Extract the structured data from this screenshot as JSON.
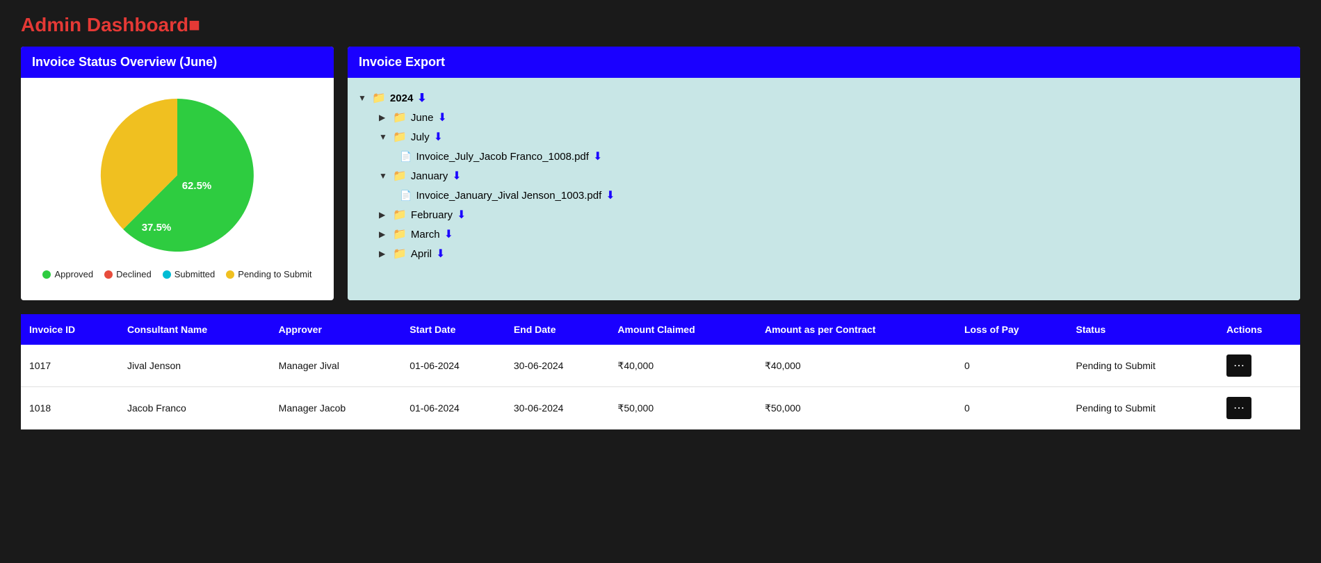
{
  "page": {
    "title": "Admin Dashboard",
    "title_accent": "!"
  },
  "statusCard": {
    "title": "Invoice Status Overview (June)",
    "chart": {
      "segments": [
        {
          "label": "Approved",
          "value": 62.5,
          "color": "#2ecc40",
          "startAngle": 0,
          "endAngle": 225
        },
        {
          "label": "Pending to Submit",
          "value": 37.5,
          "color": "#f0c020",
          "startAngle": 225,
          "endAngle": 360
        }
      ],
      "label_green": "62.5%",
      "label_yellow": "37.5%"
    },
    "legend": [
      {
        "id": "approved",
        "label": "Approved",
        "color": "#2ecc40"
      },
      {
        "id": "declined",
        "label": "Declined",
        "color": "#e74c3c"
      },
      {
        "id": "submitted",
        "label": "Submitted",
        "color": "#00bcd4"
      },
      {
        "id": "pending",
        "label": "Pending to Submit",
        "color": "#f0c020"
      }
    ]
  },
  "exportCard": {
    "title": "Invoice Export",
    "tree": {
      "year": "2024",
      "expanded": true,
      "months": [
        {
          "name": "June",
          "expanded": false,
          "files": []
        },
        {
          "name": "July",
          "expanded": true,
          "files": [
            {
              "name": "Invoice_July_Jacob Franco_1008.pdf"
            }
          ]
        },
        {
          "name": "January",
          "expanded": true,
          "files": [
            {
              "name": "Invoice_January_Jival Jenson_1003.pdf"
            }
          ]
        },
        {
          "name": "February",
          "expanded": false,
          "files": []
        },
        {
          "name": "March",
          "expanded": false,
          "files": []
        },
        {
          "name": "April",
          "expanded": false,
          "files": []
        }
      ]
    }
  },
  "table": {
    "headers": [
      "Invoice ID",
      "Consultant Name",
      "Approver",
      "Start Date",
      "End Date",
      "Amount Claimed",
      "Amount as per Contract",
      "Loss of Pay",
      "Status",
      "Actions"
    ],
    "rows": [
      {
        "id": "1017",
        "consultant": "Jival Jenson",
        "approver": "Manager Jival",
        "start_date": "01-06-2024",
        "end_date": "30-06-2024",
        "amount_claimed": "₹40,000",
        "amount_contract": "₹40,000",
        "loss_of_pay": "0",
        "status": "Pending to Submit"
      },
      {
        "id": "1018",
        "consultant": "Jacob Franco",
        "approver": "Manager Jacob",
        "start_date": "01-06-2024",
        "end_date": "30-06-2024",
        "amount_claimed": "₹50,000",
        "amount_contract": "₹50,000",
        "loss_of_pay": "0",
        "status": "Pending to Submit"
      }
    ]
  }
}
